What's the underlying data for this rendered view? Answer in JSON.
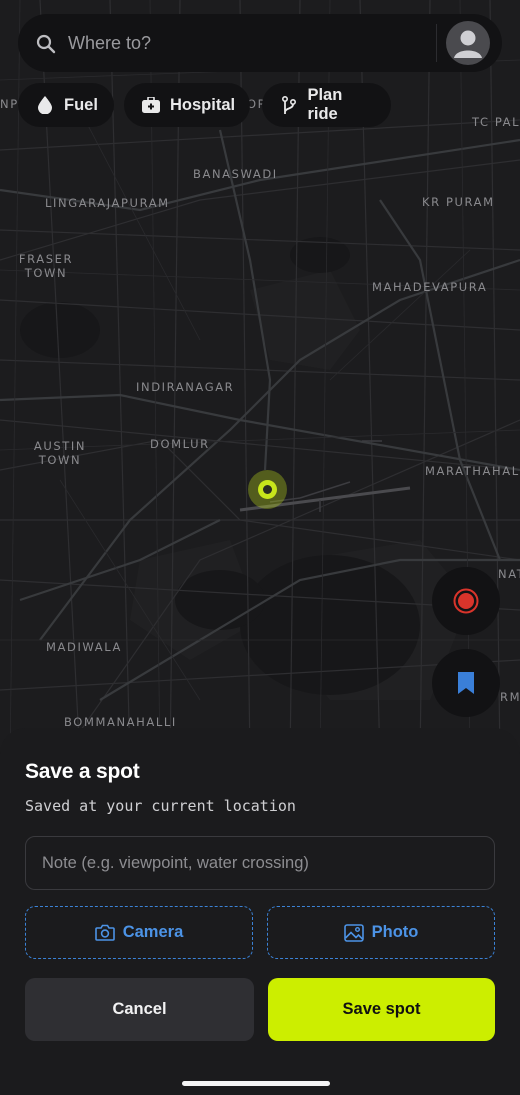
{
  "search": {
    "placeholder": "Where to?"
  },
  "chips": [
    {
      "label": "Fuel",
      "icon": "fuel-drop-icon"
    },
    {
      "label": "Hospital",
      "icon": "hospital-icon"
    },
    {
      "label": "Plan ride",
      "icon": "route-icon"
    }
  ],
  "map": {
    "labels": [
      {
        "text": "BANASWADI"
      },
      {
        "text": "LINGARAJAPURAM"
      },
      {
        "text": "KR PURAM"
      },
      {
        "text": "FRASER\nTOWN"
      },
      {
        "text": "MAHADEVAPURA"
      },
      {
        "text": "INDIRANAGAR"
      },
      {
        "text": "AUSTIN\nTOWN"
      },
      {
        "text": "DOMLUR"
      },
      {
        "text": "MARATHAHALL"
      },
      {
        "text": "MADIWALA"
      },
      {
        "text": "BOMMANAHALLI"
      },
      {
        "text": "TC PAL"
      },
      {
        "text": "NP"
      },
      {
        "text": "OR"
      },
      {
        "text": "NAT"
      },
      {
        "text": "RM"
      }
    ],
    "location_marker_color": "#c7e51b",
    "record_button_color": "#d9342b",
    "bookmark_color": "#3a7fd8"
  },
  "sheet": {
    "title": "Save a spot",
    "subtitle": "Saved at your current location",
    "note_placeholder": "Note (e.g. viewpoint, water crossing)",
    "camera_label": "Camera",
    "photo_label": "Photo",
    "cancel_label": "Cancel",
    "save_label": "Save spot"
  },
  "colors": {
    "accent": "#ccee00",
    "link_blue": "#4c93e6",
    "background": "#1b1b1d"
  }
}
